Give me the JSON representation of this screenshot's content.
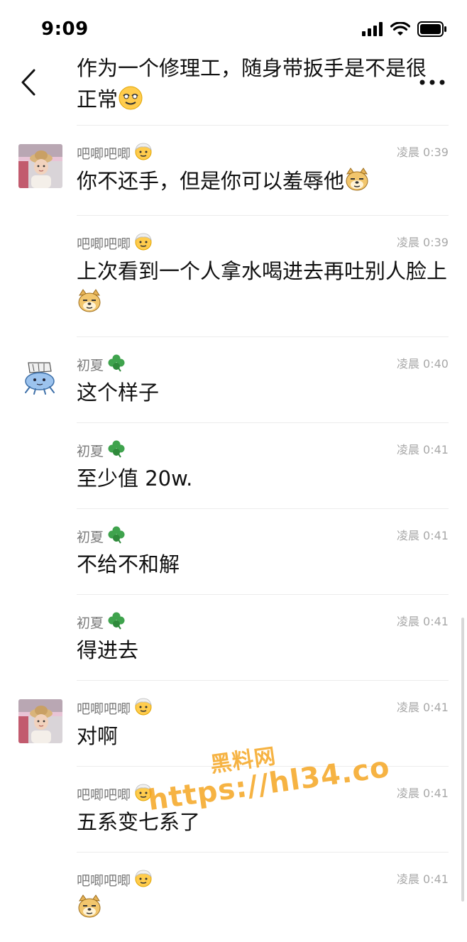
{
  "status_bar": {
    "time": "9:09"
  },
  "header": {
    "title": "作为一个修理工，随身带扳手是不是很正常",
    "back_icon": "chevron-left-icon",
    "more_icon": "more-dots-icon"
  },
  "messages": [
    {
      "sender": "吧唧吧唧",
      "time": "凌晨 0:39",
      "text": "你不还手，但是你可以羞辱他",
      "emoji": "doge",
      "avatar": "photo-kid"
    },
    {
      "sender": "吧唧吧唧",
      "time": "凌晨 0:39",
      "text": "上次看到一个人拿水喝进去再吐别人脸上",
      "emoji": "doge",
      "avatar": ""
    },
    {
      "sender": "初夏",
      "time": "凌晨 0:40",
      "text": "这个样子",
      "emoji": "",
      "avatar": "cartoon"
    },
    {
      "sender": "初夏",
      "time": "凌晨 0:41",
      "text": "至少值 20w.",
      "emoji": "",
      "avatar": ""
    },
    {
      "sender": "初夏",
      "time": "凌晨 0:41",
      "text": "不给不和解",
      "emoji": "",
      "avatar": ""
    },
    {
      "sender": "初夏",
      "time": "凌晨 0:41",
      "text": "得进去",
      "emoji": "",
      "avatar": ""
    },
    {
      "sender": "吧唧吧唧",
      "time": "凌晨 0:41",
      "text": "对啊",
      "emoji": "",
      "avatar": "photo-kid"
    },
    {
      "sender": "吧唧吧唧",
      "time": "凌晨 0:41",
      "text": "五系变七系了",
      "emoji": "",
      "avatar": ""
    },
    {
      "sender": "吧唧吧唧",
      "time": "凌晨 0:41",
      "text": "",
      "emoji": "doge",
      "avatar": ""
    }
  ],
  "watermark": {
    "line1": "黑料网",
    "line2": "https://hl34.co"
  },
  "colors": {
    "watermark": "#f5a623",
    "meta_text": "#7b7b7b",
    "time_text": "#a8a8a8",
    "divider": "#ececec"
  }
}
